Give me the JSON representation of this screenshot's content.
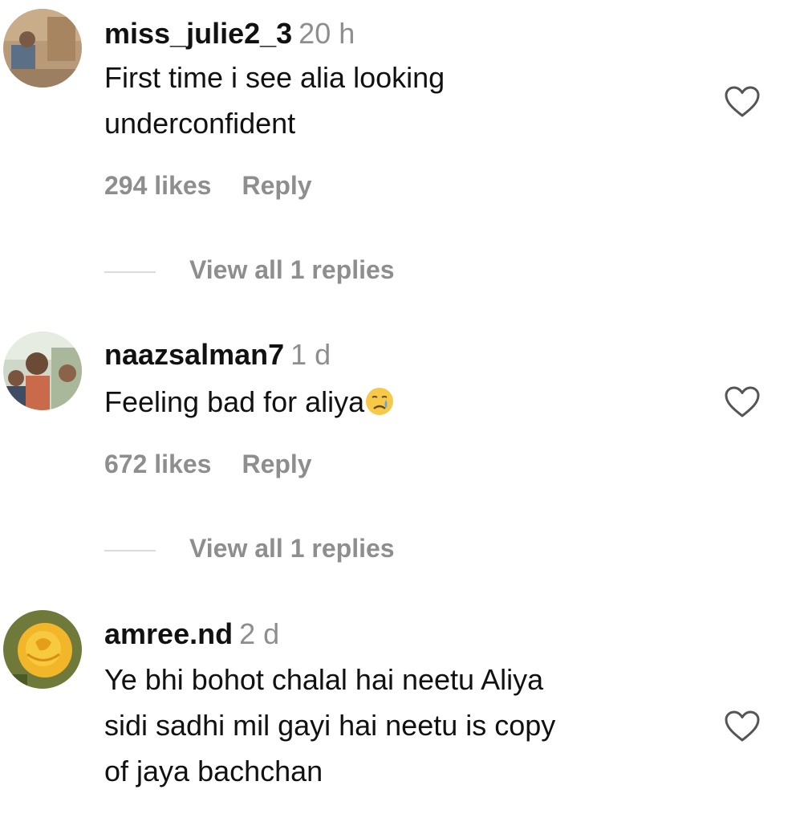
{
  "comments": [
    {
      "username": "miss_julie2_3",
      "time": "20 h",
      "lines": [
        "First time i see alia looking",
        "underconfident"
      ],
      "likes": "294 likes",
      "reply": "Reply",
      "view_replies": "View all 1 replies",
      "avatar_icon": "avatar-photo"
    },
    {
      "username": "naazsalman7",
      "time": "1 d",
      "lines": [
        "Feeling bad for aliya"
      ],
      "emoji": "crying-face-emoji",
      "likes": "672 likes",
      "reply": "Reply",
      "view_replies": "View all 1 replies",
      "avatar_icon": "avatar-photo"
    },
    {
      "username": "amree.nd",
      "time": "2 d",
      "lines": [
        "Ye bhi bohot chalal hai neetu Aliya",
        "sidi sadhi mil gayi hai neetu is copy",
        "of jaya bachchan"
      ],
      "avatar_icon": "avatar-yellow-rose"
    }
  ],
  "icons": {
    "like": "heart-outline-icon"
  },
  "colors": {
    "text": "#111111",
    "secondary": "#8e8e8e",
    "divider": "#dbdbdb",
    "background": "#ffffff"
  }
}
